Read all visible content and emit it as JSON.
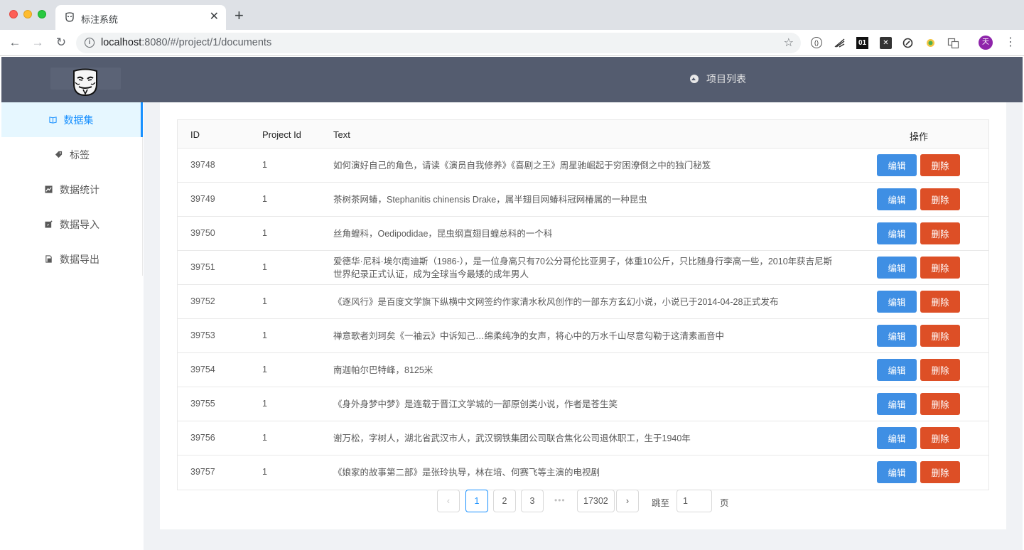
{
  "browser": {
    "tab_title": "标注系统",
    "url_host": "localhost",
    "url_rest": ":8080/#/project/1/documents",
    "avatar_letter": "天"
  },
  "header": {
    "nav_label": "项目列表"
  },
  "sidebar": {
    "items": [
      {
        "label": "数据集",
        "icon": "book-icon",
        "active": true
      },
      {
        "label": "标签",
        "icon": "tag-icon"
      },
      {
        "label": "数据统计",
        "icon": "chart-icon"
      },
      {
        "label": "数据导入",
        "icon": "edit-icon"
      },
      {
        "label": "数据导出",
        "icon": "file-icon"
      }
    ]
  },
  "table": {
    "columns": {
      "id": "ID",
      "project": "Project Id",
      "text": "Text",
      "actions": "操作"
    },
    "edit_label": "编辑",
    "delete_label": "删除",
    "rows": [
      {
        "id": "39748",
        "project": "1",
        "text": "如何演好自己的角色，请读《演员自我修养》《喜剧之王》周星驰崛起于穷困潦倒之中的独门秘笈"
      },
      {
        "id": "39749",
        "project": "1",
        "text": "茶树茶网蝽，Stephanitis chinensis Drake，属半翅目网蝽科冠网椿属的一种昆虫"
      },
      {
        "id": "39750",
        "project": "1",
        "text": "丝角蝗科，Oedipodidae，昆虫纲直翅目蝗总科的一个科"
      },
      {
        "id": "39751",
        "project": "1",
        "text": "爱德华·尼科·埃尔南迪斯（1986-），是一位身高只有70公分哥伦比亚男子，体重10公斤，只比随身行李高一些，2010年获吉尼斯世界纪录正式认证，成为全球当今最矮的成年男人"
      },
      {
        "id": "39752",
        "project": "1",
        "text": "《逐风行》是百度文学旗下纵横中文网签约作家清水秋风创作的一部东方玄幻小说，小说已于2014-04-28正式发布"
      },
      {
        "id": "39753",
        "project": "1",
        "text": "禅意歌者刘珂矣《一袖云》中诉知己…绵柔纯净的女声，将心中的万水千山尽意勾勒于这清素画音中"
      },
      {
        "id": "39754",
        "project": "1",
        "text": "南迦帕尔巴特峰，8125米"
      },
      {
        "id": "39755",
        "project": "1",
        "text": "《身外身梦中梦》是连载于晋江文学城的一部原创类小说，作者是苍生笑"
      },
      {
        "id": "39756",
        "project": "1",
        "text": "谢万松，字树人，湖北省武汉市人，武汉钢铁集团公司联合焦化公司退休职工，生于1940年"
      },
      {
        "id": "39757",
        "project": "1",
        "text": "《娘家的故事第二部》是张玲执导，林在培、何赛飞等主演的电视剧"
      }
    ]
  },
  "pagination": {
    "prev": "‹",
    "next": "›",
    "pages": [
      "1",
      "2",
      "3"
    ],
    "ellipsis": "•••",
    "last": "17302",
    "current": "1",
    "jump_label": "跳至",
    "jump_value": "1",
    "page_suffix": "页"
  }
}
